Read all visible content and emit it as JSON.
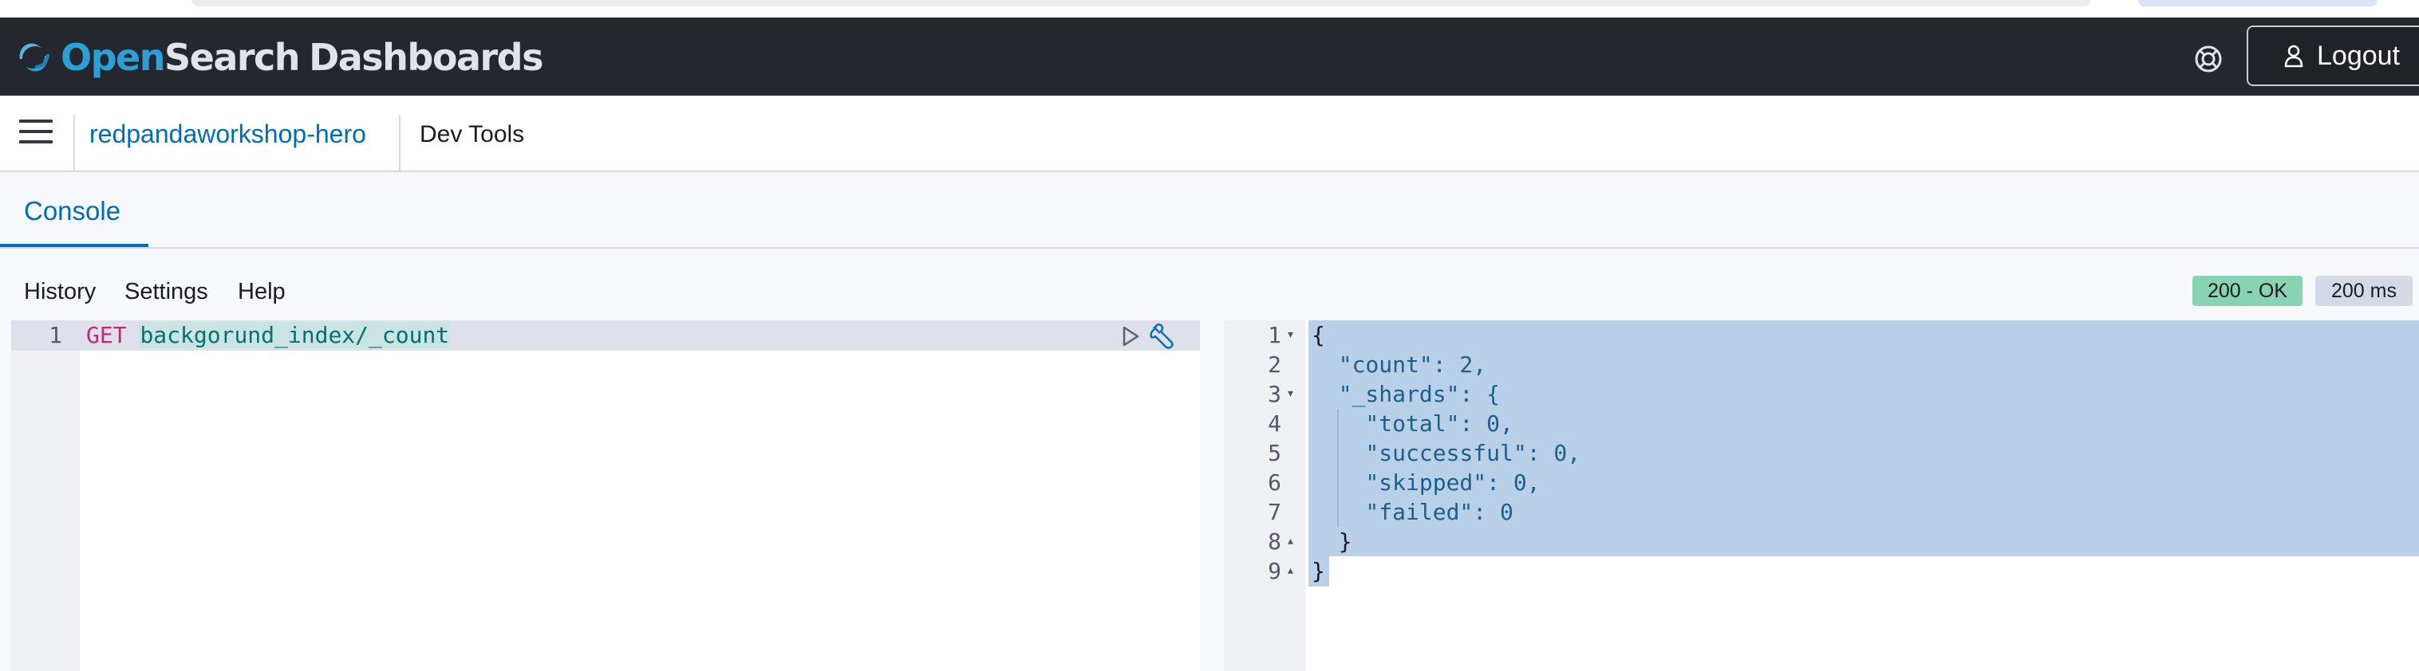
{
  "brand": {
    "part1": "Open",
    "part2": "Search",
    "part3": "Dashboards"
  },
  "topbar": {
    "logout_label": "Logout"
  },
  "breadcrumbs": {
    "space": "redpandaworkshop-hero",
    "current": "Dev Tools"
  },
  "tabs": {
    "console": "Console"
  },
  "toolbar": {
    "history": "History",
    "settings": "Settings",
    "help": "Help"
  },
  "status": {
    "code": "200 - OK",
    "time": "200 ms",
    "ok_color": "#88d4b2"
  },
  "request": {
    "line_numbers": [
      "1"
    ],
    "method": "GET",
    "path": "backgorund_index/_count"
  },
  "response": {
    "line_numbers": [
      "1",
      "2",
      "3",
      "4",
      "5",
      "6",
      "7",
      "8",
      "9"
    ],
    "lines": [
      "{",
      "  \"count\": 2,",
      "  \"_shards\": {",
      "    \"total\": 0,",
      "    \"successful\": 0,",
      "    \"skipped\": 0,",
      "    \"failed\": 0",
      "  }",
      "}"
    ]
  },
  "icons": {
    "logo": "opensearch-logo-icon",
    "help": "help-lifebuoy-icon",
    "user": "user-icon",
    "menu": "hamburger-menu-icon",
    "run": "play-icon",
    "wrench": "wrench-icon"
  }
}
